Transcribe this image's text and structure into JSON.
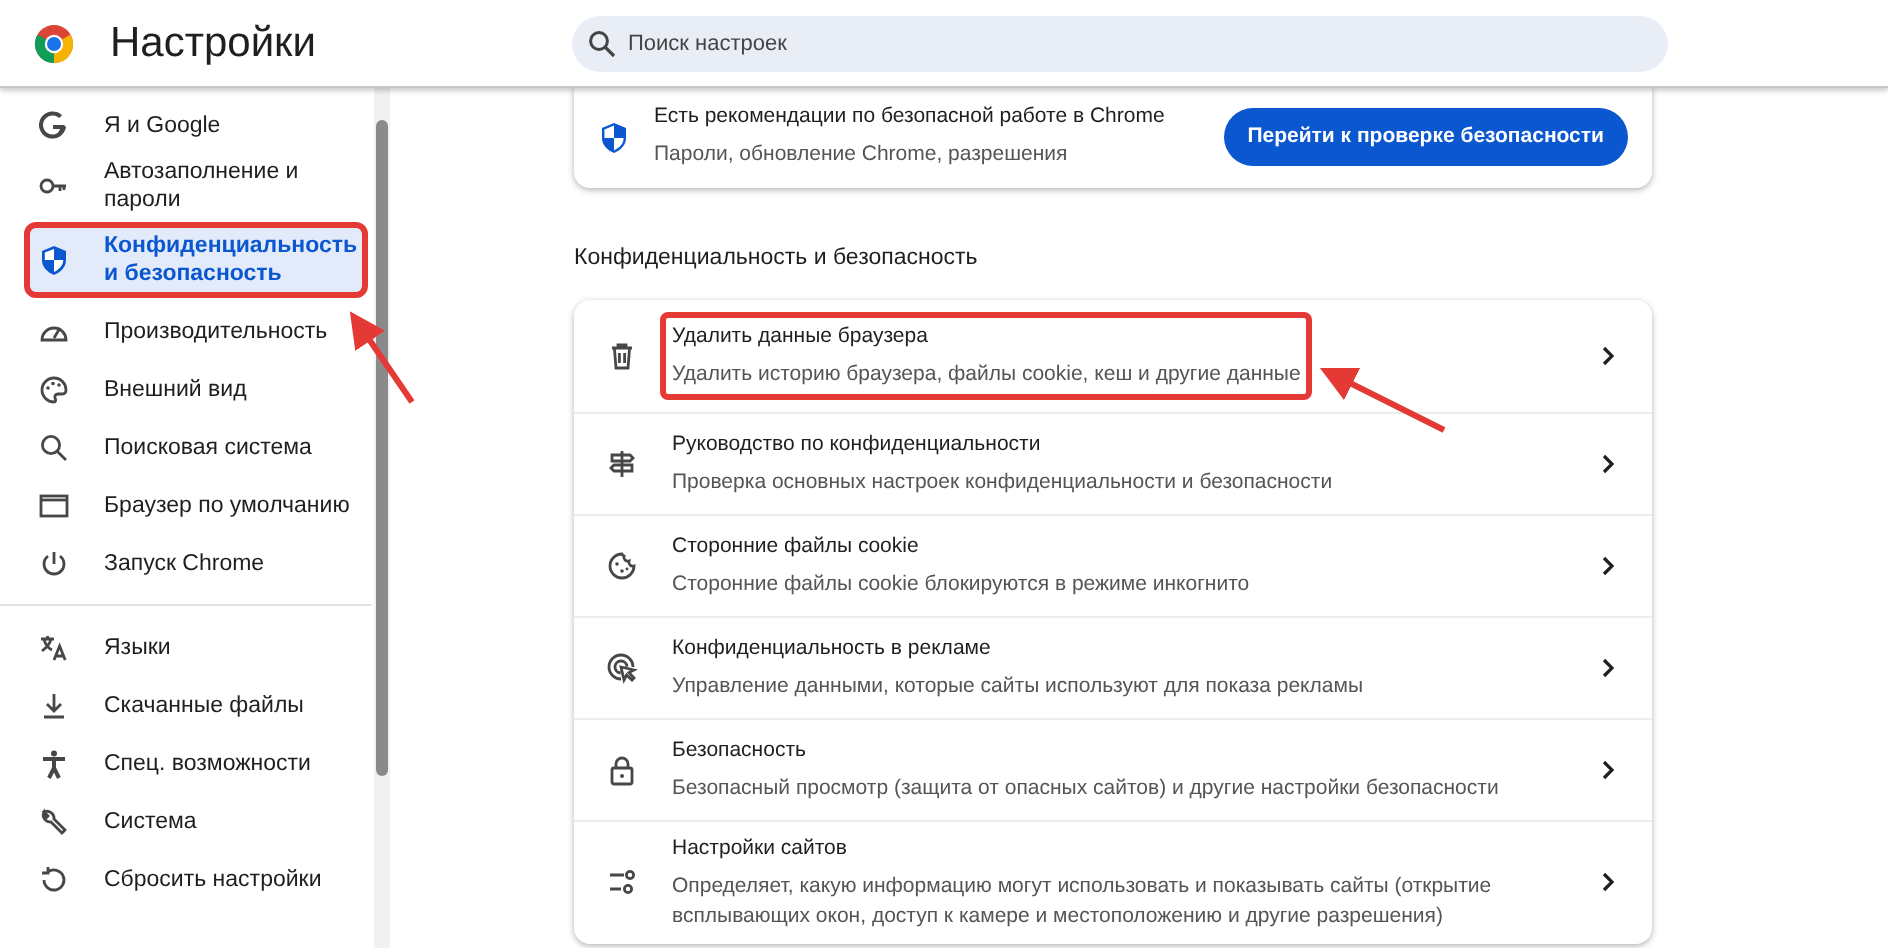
{
  "header": {
    "title": "Настройки",
    "search": {
      "placeholder": "Поиск настроек"
    }
  },
  "sidebar": {
    "groups": [
      [
        {
          "label": "Я и Google",
          "selected": false,
          "highlighted": false
        },
        {
          "label": "Автозаполнение и пароли",
          "selected": false,
          "highlighted": false
        },
        {
          "label": "Конфиденциальность и безопасность",
          "selected": true,
          "highlighted": true
        },
        {
          "label": "Производительность",
          "selected": false,
          "highlighted": false
        },
        {
          "label": "Внешний вид",
          "selected": false,
          "highlighted": false
        },
        {
          "label": "Поисковая система",
          "selected": false,
          "highlighted": false
        },
        {
          "label": "Браузер по умолчанию",
          "selected": false,
          "highlighted": false
        },
        {
          "label": "Запуск Chrome",
          "selected": false,
          "highlighted": false
        }
      ],
      [
        {
          "label": "Языки",
          "selected": false,
          "highlighted": false
        },
        {
          "label": "Скачанные файлы",
          "selected": false,
          "highlighted": false
        },
        {
          "label": "Спец. возможности",
          "selected": false,
          "highlighted": false
        },
        {
          "label": "Система",
          "selected": false,
          "highlighted": false
        },
        {
          "label": "Сбросить настройки",
          "selected": false,
          "highlighted": false
        }
      ]
    ]
  },
  "safety_card": {
    "title": "Есть рекомендации по безопасной работе в Chrome",
    "subtitle": "Пароли, обновление Chrome, разрешения",
    "button": "Перейти к проверке безопасности"
  },
  "section": {
    "title": "Конфиденциальность и безопасность",
    "rows": [
      {
        "title": "Удалить данные браузера",
        "subtitle": "Удалить историю браузера, файлы cookie, кеш и другие данные",
        "highlighted": true
      },
      {
        "title": "Руководство по конфиденциальности",
        "subtitle": "Проверка основных настроек конфиденциальности и безопасности",
        "highlighted": false
      },
      {
        "title": "Сторонние файлы cookie",
        "subtitle": "Сторонние файлы cookie блокируются в режиме инкогнито",
        "highlighted": false
      },
      {
        "title": "Конфиденциальность в рекламе",
        "subtitle": "Управление данными, которые сайты используют для показа рекламы",
        "highlighted": false
      },
      {
        "title": "Безопасность",
        "subtitle": "Безопасный просмотр (защита от опасных сайтов) и другие настройки безопасности",
        "highlighted": false
      },
      {
        "title": "Настройки сайтов",
        "subtitle": "Определяет, какую информацию могут использовать и показывать сайты (открытие всплывающих окон, доступ к камере и местоположению и другие разрешения)",
        "highlighted": false
      }
    ]
  }
}
